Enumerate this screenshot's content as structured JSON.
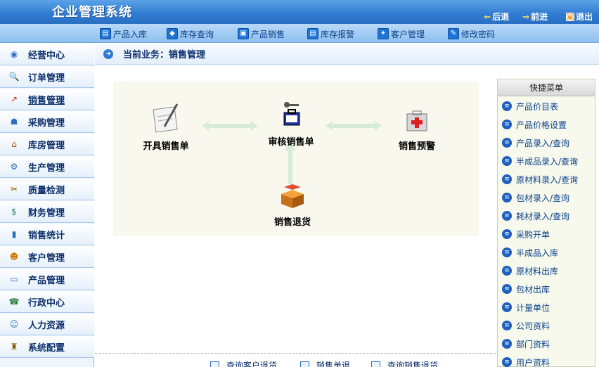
{
  "header": {
    "title": "企业管理系统",
    "back_label": "后退",
    "forward_label": "前进",
    "exit_label": "退出"
  },
  "toolbar": {
    "items": [
      {
        "label": "产品入库",
        "icon": "product-in-icon"
      },
      {
        "label": "库存查询",
        "icon": "inventory-query-icon"
      },
      {
        "label": "产品销售",
        "icon": "product-sales-icon"
      },
      {
        "label": "库存报警",
        "icon": "inventory-alert-icon"
      },
      {
        "label": "客户管理",
        "icon": "customer-icon"
      },
      {
        "label": "修改密码",
        "icon": "password-icon"
      }
    ]
  },
  "sidebar": {
    "active_index": 2,
    "items": [
      {
        "label": "经营中心",
        "icon": "operations-icon"
      },
      {
        "label": "订单管理",
        "icon": "order-icon"
      },
      {
        "label": "销售管理",
        "icon": "sales-chart-icon"
      },
      {
        "label": "采购管理",
        "icon": "purchase-icon"
      },
      {
        "label": "库房管理",
        "icon": "warehouse-icon"
      },
      {
        "label": "生产管理",
        "icon": "production-icon"
      },
      {
        "label": "质量检测",
        "icon": "quality-icon"
      },
      {
        "label": "财务管理",
        "icon": "finance-icon"
      },
      {
        "label": "销售统计",
        "icon": "statistics-icon"
      },
      {
        "label": "客户管理",
        "icon": "customer-icon"
      },
      {
        "label": "产品管理",
        "icon": "product-icon"
      },
      {
        "label": "行政中心",
        "icon": "admin-icon"
      },
      {
        "label": "人力资源",
        "icon": "hr-icon"
      },
      {
        "label": "系统配置",
        "icon": "settings-icon"
      }
    ]
  },
  "breadcrumb": {
    "text": "当前业务：销售管理"
  },
  "flow": {
    "create_order": "开具销售单",
    "review_order": "审核销售单",
    "sales_alert": "销售预警",
    "sales_return": "销售退货"
  },
  "bottom_links": {
    "items": [
      "查询客户退货",
      "销售单退",
      "查询销售退货"
    ]
  },
  "quick_menu": {
    "title": "快捷菜单",
    "items": [
      "产品价目表",
      "产品价格设置",
      "产品录入/查询",
      "半成品录入/查询",
      "原材料录入/查询",
      "包材录入/查询",
      "耗材录入/查询",
      "采购开单",
      "半成品入库",
      "原材料出库",
      "包材出库",
      "计量单位",
      "公司资料",
      "部门资料",
      "用户资料"
    ]
  },
  "colors": {
    "header_blue": "#2f7ad0",
    "toolbar_blue": "#8ec0ef",
    "sidebar_text": "#0c2f6b",
    "quick_bg": "#f6f9ec",
    "flow_bg": "#f8f8ef"
  }
}
